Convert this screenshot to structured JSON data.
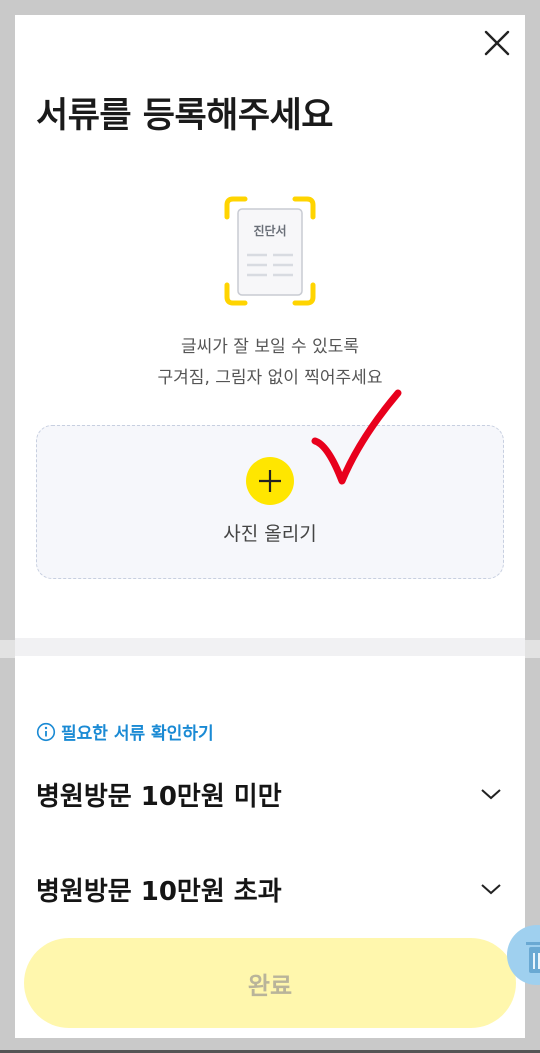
{
  "header": {
    "title": "서류를 등록해주세요",
    "close_icon": "close-icon"
  },
  "illustration": {
    "doc_label": "진단서",
    "frame_color": "#ffd400"
  },
  "guide": {
    "line1": "글씨가 잘 보일 수 있도록",
    "line2": "구겨짐, 그림자 없이 찍어주세요"
  },
  "upload": {
    "label": "사진 올리기",
    "icon": "plus-icon",
    "accent": "#ffe600"
  },
  "info": {
    "link_label": "필요한 서류 확인하기",
    "icon": "info-icon",
    "color": "#1a8ad4"
  },
  "accordions": [
    {
      "label": "병원방문 10만원 미만",
      "icon": "chevron-down-icon"
    },
    {
      "label": "병원방문 10만원 초과",
      "icon": "chevron-down-icon"
    }
  ],
  "footer": {
    "done_label": "완료",
    "done_bg": "#fff7ad"
  },
  "floating": {
    "icon": "trash-icon"
  }
}
